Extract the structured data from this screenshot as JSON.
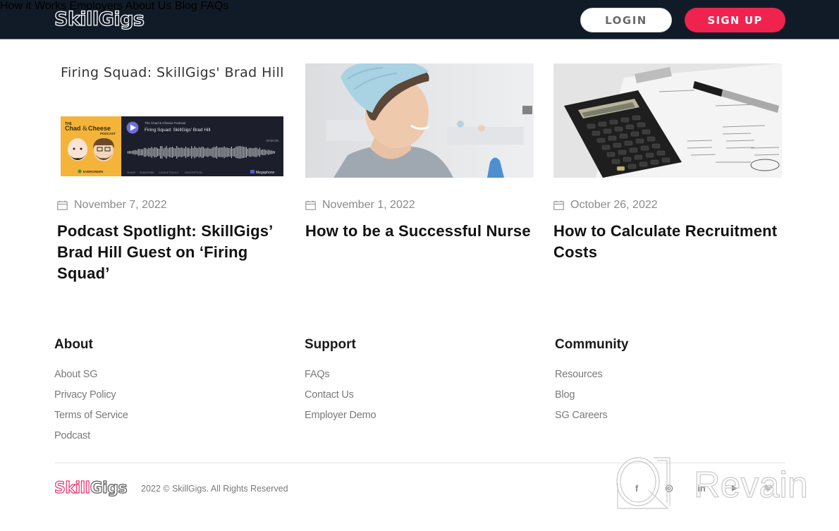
{
  "header": {
    "brand": "SkillGigs",
    "nav": [
      "How it Works",
      "Employers",
      "About Us",
      "Blog",
      "FAQs"
    ],
    "login_label": "LOGIN",
    "signup_label": "SIGN UP",
    "colors": {
      "bg": "#111b27",
      "signup": "#f0224e"
    }
  },
  "posts": [
    {
      "thumb_heading": "Firing Squad: SkillGigs' Brad Hill",
      "player": {
        "show_top": "THE",
        "show_name_1": "Chad",
        "show_amp": "&",
        "show_name_2": "Cheese",
        "show_sub": "PODCAST",
        "badge": "EVERGREEN",
        "podcast_name": "The Chad & Cheese Podcast",
        "episode": "Firing Squad: SkillGigs' Brad Hill",
        "time": "00:00:00",
        "links": [
          "SHARE",
          "SUBSCRIBE",
          "COOKIE POLICY",
          "DESCRIPTION"
        ],
        "provider": "Megaphone"
      },
      "date": "November 7, 2022",
      "title": "Podcast Spotlight: SkillGigs’ Brad Hill Guest on ‘Firing Squad’"
    },
    {
      "image_alt": "Smiling nurse in surgical cap",
      "date": "November 1, 2022",
      "title": "How to be a Successful Nurse"
    },
    {
      "image_alt": "Calculator and pen on financial papers",
      "date": "October 26, 2022",
      "title": "How to Calculate Recruitment Costs"
    }
  ],
  "footer": {
    "columns": [
      {
        "heading": "About",
        "links": [
          "About SG",
          "Privacy Policy",
          "Terms of Service",
          "Podcast"
        ]
      },
      {
        "heading": "Support",
        "links": [
          "FAQs",
          "Contact Us",
          "Employer Demo"
        ]
      },
      {
        "heading": "Community",
        "links": [
          "Resources",
          "Blog",
          "SG Careers"
        ]
      }
    ],
    "brand": "SkillGigs",
    "copyright": "2022 © SkillGigs. All Rights Reserved",
    "social": [
      {
        "name": "facebook",
        "glyph": "f"
      },
      {
        "name": "instagram",
        "glyph": "◎"
      },
      {
        "name": "linkedin",
        "glyph": "in"
      },
      {
        "name": "youtube",
        "glyph": "▶"
      },
      {
        "name": "twitter",
        "glyph": "🐦"
      }
    ]
  },
  "watermark": {
    "text": "Revain"
  }
}
